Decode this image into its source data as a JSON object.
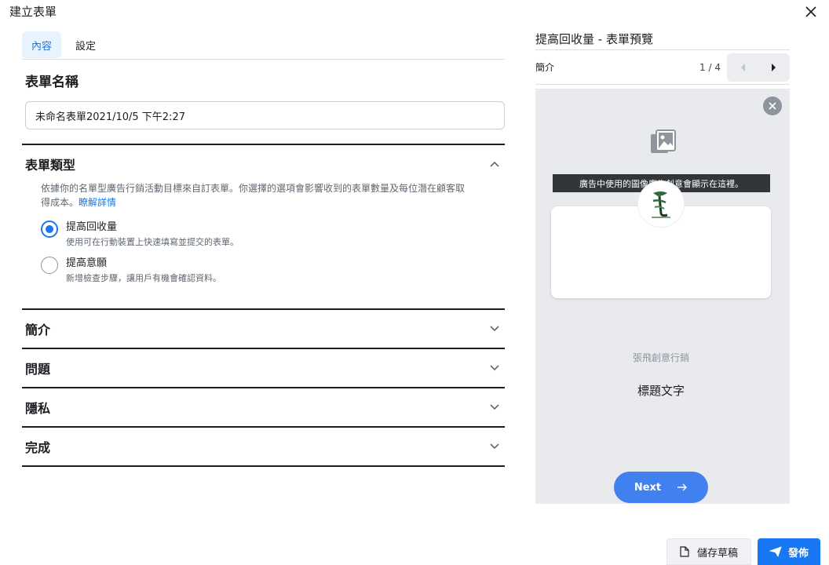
{
  "header": {
    "title": "建立表單"
  },
  "tabs": [
    {
      "label": "內容"
    },
    {
      "label": "設定"
    }
  ],
  "form_name": {
    "label": "表單名稱",
    "value": "未命名表單2021/10/5 下午2:27"
  },
  "form_type": {
    "title": "表單類型",
    "description": "依據你的名單型廣告行銷活動目標來自訂表單。你選擇的選項會影響收到的表單數量及每位潛在顧客取得成本。",
    "learn_more": "瞭解詳情",
    "options": [
      {
        "label": "提高回收量",
        "sub": "使用可在行動裝置上快速填寫並提交的表單。",
        "selected": true
      },
      {
        "label": "提高意願",
        "sub": "新增檢查步驟，讓用戶有機會確認資料。",
        "selected": false
      }
    ]
  },
  "sections": [
    {
      "title": "簡介"
    },
    {
      "title": "問題"
    },
    {
      "title": "隱私"
    },
    {
      "title": "完成"
    }
  ],
  "preview": {
    "title": "提高回收量 - 表單預覽",
    "page_label": "簡介",
    "page_count": "1 / 4",
    "image_banner": "廣告中使用的圖像廣告創意會顯示在這裡。",
    "brand_name": "張飛創意行銷",
    "headline": "標題文字",
    "next_label": "Next"
  },
  "footer": {
    "draft_label": "儲存草稿",
    "publish_label": "發佈"
  },
  "colors": {
    "accent": "#1877f2",
    "next_button": "#4080ef",
    "preview_bg": "#e9eaed",
    "banner_bg": "#333639"
  }
}
